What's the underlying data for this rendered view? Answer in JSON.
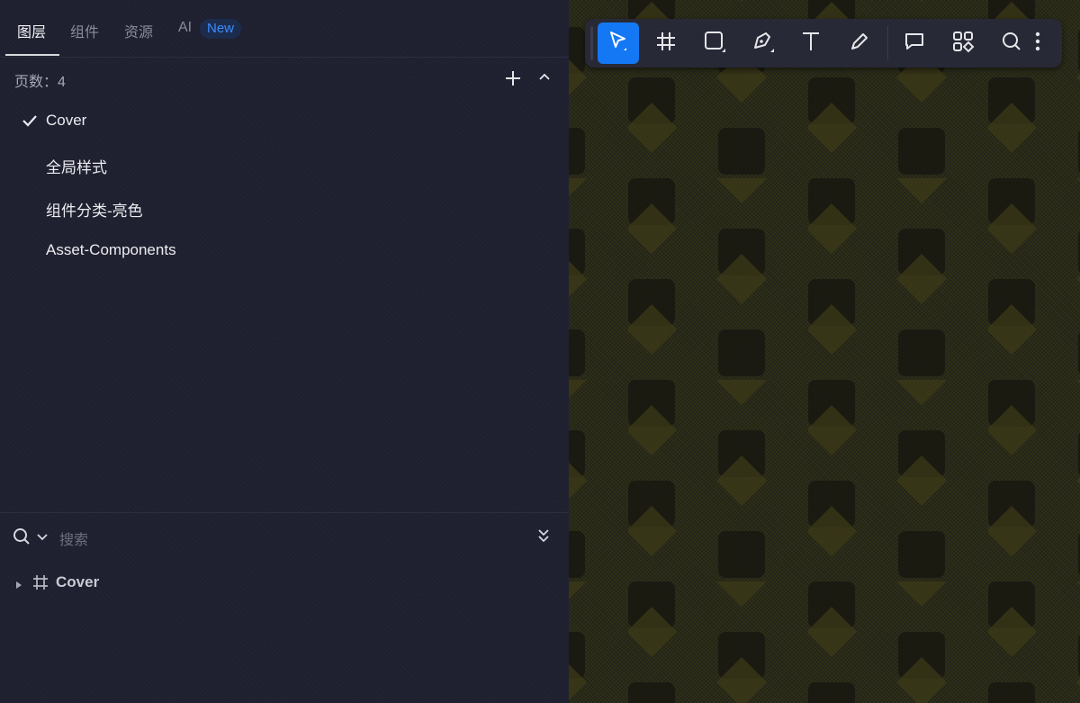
{
  "tabs": [
    {
      "label": "图层",
      "active": true
    },
    {
      "label": "组件",
      "active": false
    },
    {
      "label": "资源",
      "active": false
    },
    {
      "label": "AI",
      "active": false,
      "badge": "New"
    }
  ],
  "pages": {
    "count_label": "页数：4",
    "items": [
      {
        "label": "Cover",
        "selected": true
      },
      {
        "label": "全局样式",
        "selected": false
      },
      {
        "label": "组件分类-亮色",
        "selected": false
      },
      {
        "label": "Asset-Components",
        "selected": false
      }
    ]
  },
  "layers": {
    "search_placeholder": "搜索",
    "items": [
      {
        "label": "Cover",
        "icon": "frame-icon",
        "expanded": false
      }
    ]
  },
  "toolbar": {
    "tools": [
      {
        "name": "move-tool",
        "icon": "cursor-arrow-icon",
        "active": true
      },
      {
        "name": "frame-tool",
        "icon": "hash-frame-icon",
        "active": false
      },
      {
        "name": "rectangle-tool",
        "icon": "rectangle-icon",
        "active": false
      },
      {
        "name": "pen-tool",
        "icon": "pen-nib-icon",
        "active": false
      },
      {
        "name": "text-tool",
        "icon": "text-t-icon",
        "active": false
      },
      {
        "name": "pencil-tool",
        "icon": "pencil-icon",
        "active": false
      },
      {
        "name": "comment-tool",
        "icon": "comment-bubble-icon",
        "active": false
      },
      {
        "name": "components-tool",
        "icon": "components-grid-icon",
        "active": false
      },
      {
        "name": "search-tool",
        "icon": "search-icon",
        "active": false
      },
      {
        "name": "more-tool",
        "icon": "more-vertical-icon",
        "active": false
      }
    ]
  },
  "colors": {
    "panel_bg": "#1e2030",
    "canvas_bg": "#22231a",
    "accent": "#1478f5",
    "badge_text": "#3d8bff"
  }
}
